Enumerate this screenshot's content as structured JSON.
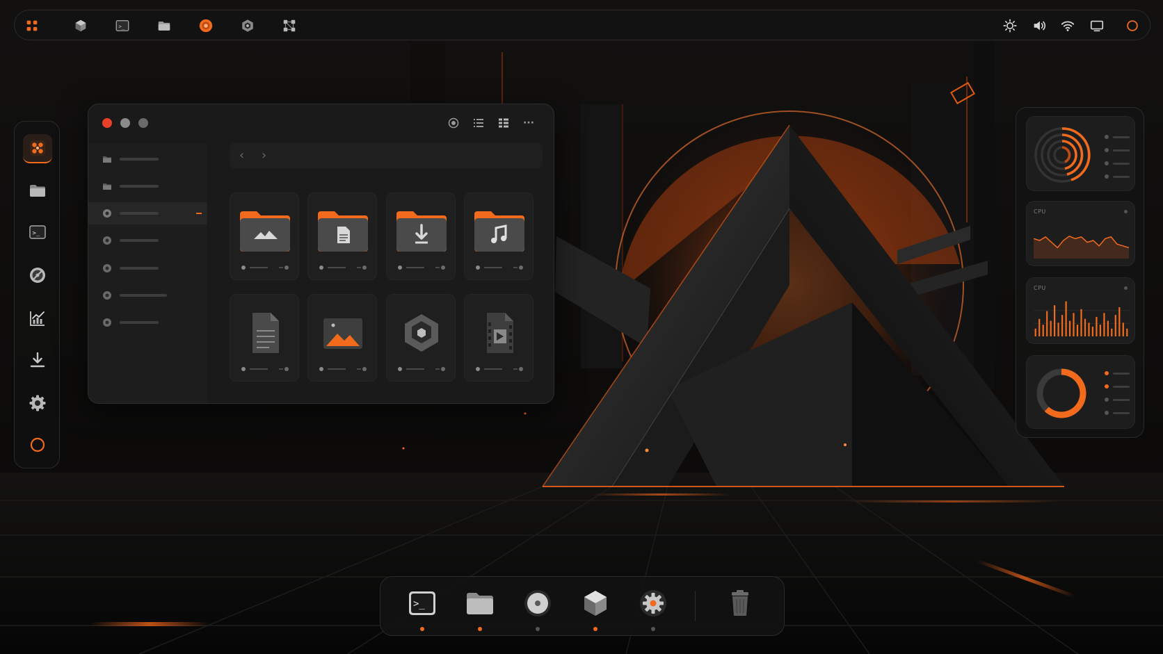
{
  "theme": {
    "accent": "#f26b1d",
    "panel": "#1a1a1a",
    "icon": "#b8b8b8",
    "close_dot": "#e8402a",
    "min_dot": "#8a8a8a",
    "max_dot": "#6a6a6a"
  },
  "topbar": {
    "left_icons": [
      "apps-grid-icon",
      "package-icon",
      "terminal-icon",
      "folder-icon",
      "browser-icon",
      "hexagon-app-icon",
      "network-icon"
    ],
    "right_icons": [
      "brightness-icon",
      "volume-icon",
      "wifi-icon",
      "display-icon",
      "power-icon"
    ],
    "terminal_prompt": ">_"
  },
  "left_dock": {
    "items": [
      "apps",
      "folder",
      "terminal",
      "disc",
      "charts",
      "downloads",
      "settings",
      "power"
    ],
    "terminal_prompt": ">_"
  },
  "file_manager": {
    "nav_back": "‹",
    "nav_forward": "›",
    "tools": [
      "record-icon",
      "list-view-icon",
      "grid-view-icon",
      "more-icon"
    ],
    "more_glyph": "···",
    "sidebar_item_count": 7,
    "active_sidebar_index": 2,
    "files": [
      {
        "type": "pictures-folder"
      },
      {
        "type": "documents-folder"
      },
      {
        "type": "downloads-folder"
      },
      {
        "type": "music-folder"
      },
      {
        "type": "text-document"
      },
      {
        "type": "image-file"
      },
      {
        "type": "package-file"
      },
      {
        "type": "video-file"
      }
    ]
  },
  "widgets": {
    "card2_label": "CPU",
    "card3_label": "CPU",
    "cpu_line": [
      0.55,
      0.5,
      0.6,
      0.45,
      0.3,
      0.5,
      0.62,
      0.55,
      0.6,
      0.45,
      0.5,
      0.35,
      0.55,
      0.6,
      0.4,
      0.35,
      0.3
    ],
    "cpu_bars": [
      0.2,
      0.45,
      0.3,
      0.65,
      0.4,
      0.8,
      0.35,
      0.55,
      0.9,
      0.4,
      0.6,
      0.3,
      0.7,
      0.45,
      0.35,
      0.25,
      0.5,
      0.3,
      0.6,
      0.4,
      0.2,
      0.55,
      0.75,
      0.35,
      0.2
    ],
    "donut_fraction": 0.62
  },
  "bottom_dock": {
    "items": [
      "terminal",
      "folder",
      "browser",
      "package",
      "settings",
      "trash"
    ],
    "terminal_prompt": ">_",
    "running": [
      true,
      true,
      false,
      true,
      false,
      false
    ]
  }
}
